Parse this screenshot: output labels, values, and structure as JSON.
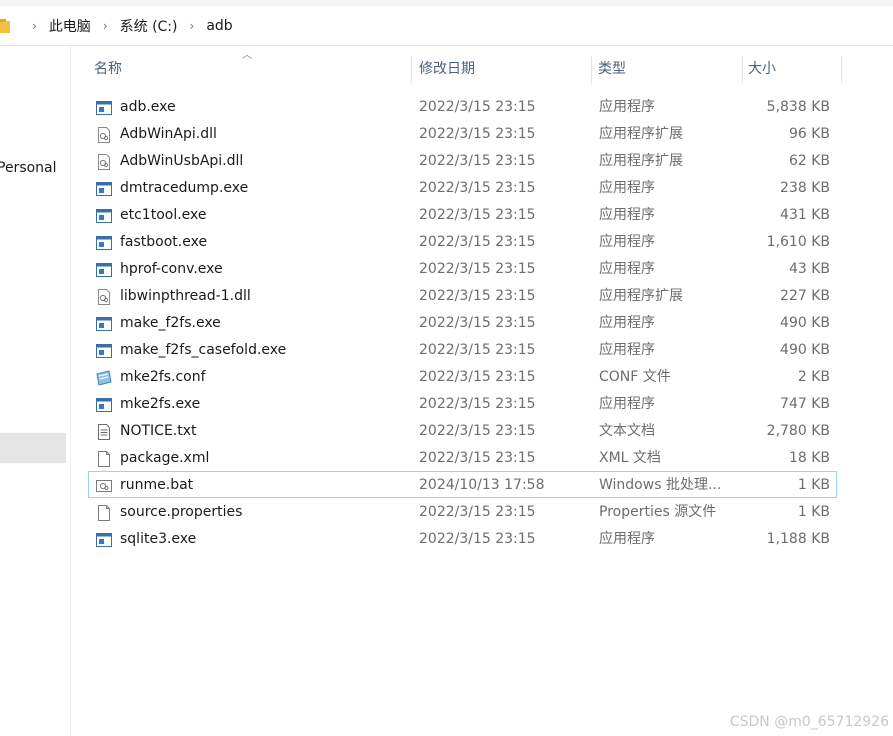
{
  "breadcrumb": [
    "此电脑",
    "系统 (C:)",
    "adb"
  ],
  "nav": {
    "personal_label": "Personal"
  },
  "columns": {
    "name": "名称",
    "date": "修改日期",
    "type": "类型",
    "size": "大小"
  },
  "files": [
    {
      "name": "adb.exe",
      "date": "2022/3/15 23:15",
      "type": "应用程序",
      "size": "5,838 KB",
      "icon": "exe-icon"
    },
    {
      "name": "AdbWinApi.dll",
      "date": "2022/3/15 23:15",
      "type": "应用程序扩展",
      "size": "96 KB",
      "icon": "dll-icon"
    },
    {
      "name": "AdbWinUsbApi.dll",
      "date": "2022/3/15 23:15",
      "type": "应用程序扩展",
      "size": "62 KB",
      "icon": "dll-icon"
    },
    {
      "name": "dmtracedump.exe",
      "date": "2022/3/15 23:15",
      "type": "应用程序",
      "size": "238 KB",
      "icon": "exe-icon"
    },
    {
      "name": "etc1tool.exe",
      "date": "2022/3/15 23:15",
      "type": "应用程序",
      "size": "431 KB",
      "icon": "exe-icon"
    },
    {
      "name": "fastboot.exe",
      "date": "2022/3/15 23:15",
      "type": "应用程序",
      "size": "1,610 KB",
      "icon": "exe-icon"
    },
    {
      "name": "hprof-conv.exe",
      "date": "2022/3/15 23:15",
      "type": "应用程序",
      "size": "43 KB",
      "icon": "exe-icon"
    },
    {
      "name": "libwinpthread-1.dll",
      "date": "2022/3/15 23:15",
      "type": "应用程序扩展",
      "size": "227 KB",
      "icon": "dll-icon"
    },
    {
      "name": "make_f2fs.exe",
      "date": "2022/3/15 23:15",
      "type": "应用程序",
      "size": "490 KB",
      "icon": "exe-icon"
    },
    {
      "name": "make_f2fs_casefold.exe",
      "date": "2022/3/15 23:15",
      "type": "应用程序",
      "size": "490 KB",
      "icon": "exe-icon"
    },
    {
      "name": "mke2fs.conf",
      "date": "2022/3/15 23:15",
      "type": "CONF 文件",
      "size": "2 KB",
      "icon": "conf-icon"
    },
    {
      "name": "mke2fs.exe",
      "date": "2022/3/15 23:15",
      "type": "应用程序",
      "size": "747 KB",
      "icon": "exe-icon"
    },
    {
      "name": "NOTICE.txt",
      "date": "2022/3/15 23:15",
      "type": "文本文档",
      "size": "2,780 KB",
      "icon": "txt-icon"
    },
    {
      "name": "package.xml",
      "date": "2022/3/15 23:15",
      "type": "XML 文档",
      "size": "18 KB",
      "icon": "blank-file-icon"
    },
    {
      "name": "runme.bat",
      "date": "2024/10/13 17:58",
      "type": "Windows 批处理...",
      "size": "1 KB",
      "icon": "bat-icon",
      "selected": true
    },
    {
      "name": "source.properties",
      "date": "2022/3/15 23:15",
      "type": "Properties 源文件",
      "size": "1 KB",
      "icon": "blank-file-icon"
    },
    {
      "name": "sqlite3.exe",
      "date": "2022/3/15 23:15",
      "type": "应用程序",
      "size": "1,188 KB",
      "icon": "exe-icon"
    }
  ],
  "watermark": "CSDN @m0_65712926",
  "colors": {
    "header_text": "#4c607a",
    "selection_border": "#99d1ff",
    "nav_selected": "#e5e5e5"
  }
}
